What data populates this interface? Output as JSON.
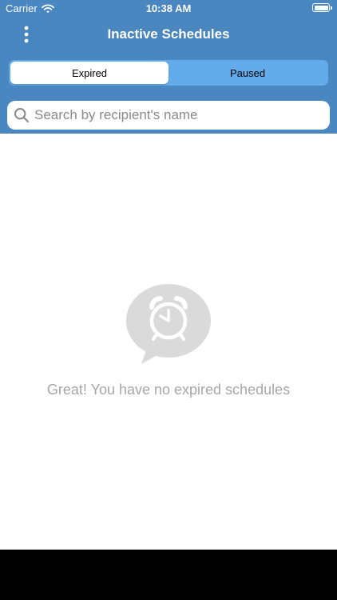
{
  "status_bar": {
    "carrier": "Carrier",
    "time": "10:38 AM"
  },
  "header": {
    "title": "Inactive Schedules",
    "menu_icon": "more-vertical-icon"
  },
  "tabs": [
    {
      "label": "Expired",
      "selected": true
    },
    {
      "label": "Paused",
      "selected": false
    }
  ],
  "search": {
    "placeholder": "Search by recipient's name",
    "value": "",
    "icon": "search-icon"
  },
  "empty_state": {
    "icon": "alarm-clock-bubble-icon",
    "message": "Great! You have no expired schedules"
  },
  "colors": {
    "header_bg": "#4a87c0",
    "segment_bg": "#62acec",
    "empty_icon": "#dadada",
    "empty_text": "#a7a7a7"
  }
}
